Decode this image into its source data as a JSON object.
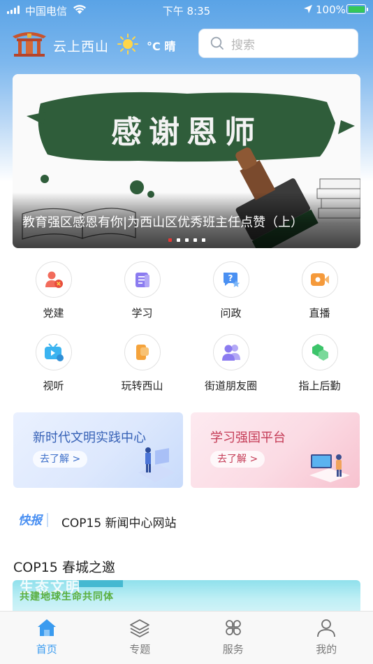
{
  "status_bar": {
    "carrier": "中国电信",
    "time": "下午 8:35",
    "battery": "100%"
  },
  "header": {
    "app_title": "云上西山",
    "weather": "°C 晴",
    "search_placeholder": "搜索"
  },
  "banner": {
    "board_text": "感谢恩师",
    "caption": "教育强区感恩有你|为西山区优秀班主任点赞（上）",
    "dots": 5,
    "active_dot": 0
  },
  "grid": {
    "items": [
      {
        "label": "党建",
        "icon": "party-icon",
        "color": "#f26b5b"
      },
      {
        "label": "学习",
        "icon": "study-icon",
        "color": "#8b7bf0"
      },
      {
        "label": "问政",
        "icon": "inquiry-icon",
        "color": "#4a90f2"
      },
      {
        "label": "直播",
        "icon": "live-icon",
        "color": "#f59a3b"
      },
      {
        "label": "视听",
        "icon": "video-icon",
        "color": "#3ab3f0"
      },
      {
        "label": "玩转西山",
        "icon": "flag-icon",
        "color": "#f5a33b"
      },
      {
        "label": "街道朋友圈",
        "icon": "people-icon",
        "color": "#8b7bf0"
      },
      {
        "label": "指上后勤",
        "icon": "hexagon-icon",
        "color": "#3cc46a"
      }
    ]
  },
  "cards": [
    {
      "title": "新时代文明实践中心",
      "button": "去了解 >"
    },
    {
      "title": "学习强国平台",
      "button": "去了解 >"
    }
  ],
  "flash": {
    "icon_text": "快报",
    "headline": "COP15 新闻中心网站"
  },
  "section": {
    "title": "COP15 春城之邀",
    "banner_line1": "生态文明",
    "banner_line2": "共建地球生命共同体"
  },
  "tabbar": [
    {
      "label": "首页",
      "active": true
    },
    {
      "label": "专题",
      "active": false
    },
    {
      "label": "服务",
      "active": false
    },
    {
      "label": "我的",
      "active": false
    }
  ],
  "colors": {
    "accent": "#3a9bef",
    "header_gradient_top": "#5aa3e6"
  }
}
